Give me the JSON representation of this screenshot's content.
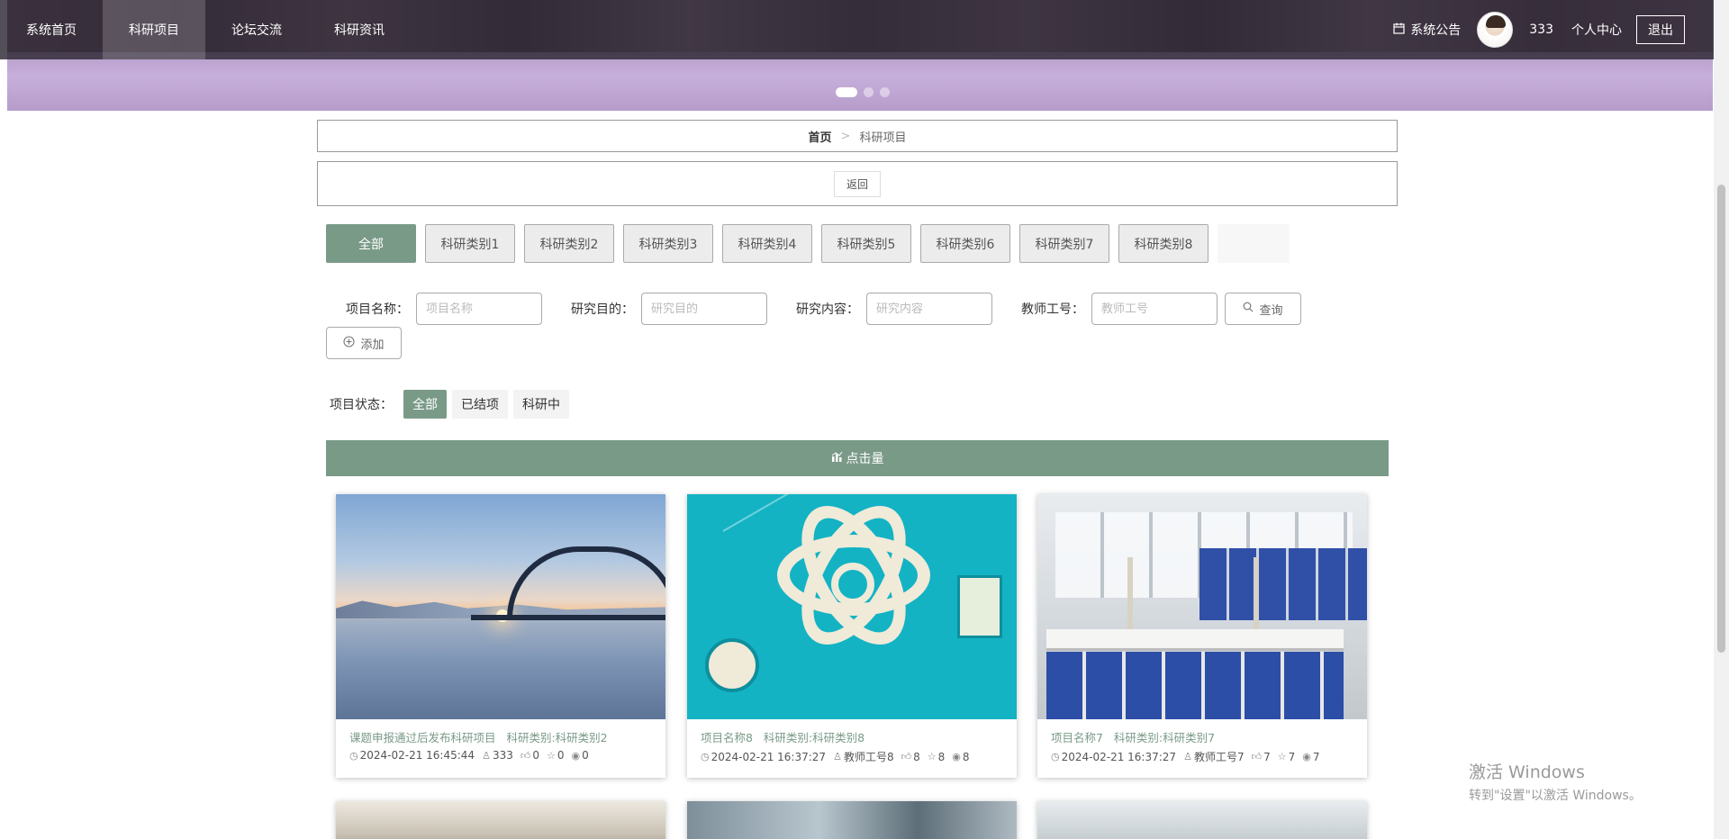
{
  "nav": {
    "items": [
      "系统首页",
      "科研项目",
      "论坛交流",
      "科研资讯"
    ],
    "notice_label": "系统公告",
    "username": "333",
    "personal_center": "个人中心",
    "logout": "退出"
  },
  "breadcrumb": {
    "home": "首页",
    "separator": ">",
    "current": "科研项目"
  },
  "back_button": "返回",
  "categories": [
    "全部",
    "科研类别1",
    "科研类别2",
    "科研类别3",
    "科研类别4",
    "科研类别5",
    "科研类别6",
    "科研类别7",
    "科研类别8"
  ],
  "search": {
    "fields": [
      {
        "label": "项目名称：",
        "placeholder": "项目名称"
      },
      {
        "label": "研究目的：",
        "placeholder": "研究目的"
      },
      {
        "label": "研究内容：",
        "placeholder": "研究内容"
      },
      {
        "label": "教师工号：",
        "placeholder": "教师工号"
      }
    ],
    "query_button": "查询",
    "add_button": "添加"
  },
  "status_filter": {
    "label": "项目状态：",
    "options": [
      "全部",
      "已结项",
      "科研中"
    ]
  },
  "sort_bar": {
    "label": "点击量"
  },
  "cards": [
    {
      "title": "课题申报通过后发布科研项目",
      "category": "科研类别:科研类别2",
      "date": "2024-02-21 16:45:44",
      "author": "333",
      "likes": "0",
      "favorites": "0",
      "views": "0"
    },
    {
      "title": "项目名称8",
      "category": "科研类别:科研类别8",
      "date": "2024-02-21 16:37:27",
      "author": "教师工号8",
      "likes": "8",
      "favorites": "8",
      "views": "8"
    },
    {
      "title": "项目名称7",
      "category": "科研类别:科研类别7",
      "date": "2024-02-21 16:37:27",
      "author": "教师工号7",
      "likes": "7",
      "favorites": "7",
      "views": "7"
    }
  ],
  "watermark": {
    "title": "激活 Windows",
    "subtitle": "转到\"设置\"以激活 Windows。"
  },
  "colors": {
    "accent": "#7a9a88",
    "nav_bg": "#2d2834"
  }
}
